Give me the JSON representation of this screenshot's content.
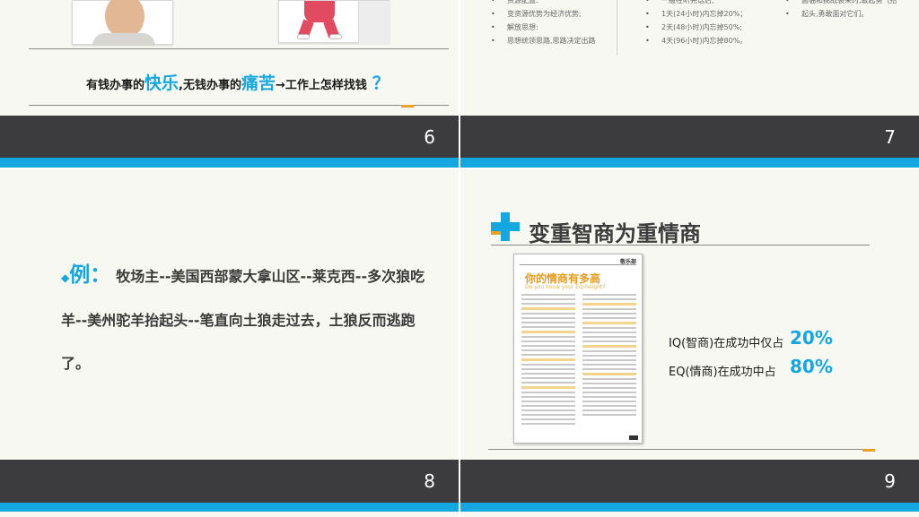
{
  "colors": {
    "accent_blue": "#14a7e0",
    "accent_orange": "#f0a020",
    "footer_bg": "#3c3c3e",
    "slide_bg": "#f8f8f3"
  },
  "slide6": {
    "number": "6",
    "heading_parts": [
      "有钱办事的",
      "快乐",
      ",无钱办事的",
      "痛苦",
      "→工作上怎样找钱",
      "？"
    ]
  },
  "slide7": {
    "number": "7",
    "col1": [
      "资源配置:",
      "变资源优势为经济优势;",
      "解放思想:",
      "思想统领思路,思路决定出路"
    ],
    "col2": [
      "一般在听完话后,",
      "1天(24小时)内忘掉20%；",
      "2天(48小时)内忘掉50%;",
      "4天(96小时)内忘掉80%。"
    ],
    "col3": [
      "面临和挑战袭来时,敢起勇气抬",
      "起头,勇敢面对它们。"
    ]
  },
  "slide8": {
    "number": "8",
    "example_label": "例：",
    "example_text": "牧场主--美国西部蒙大拿山区--莱克西--多次狼吃羊--美州驼羊抬起头--笔直向土狼走过去，土狼反而逃跑了。"
  },
  "slide9": {
    "number": "9",
    "title": "变重智商为重情商",
    "magazine_title": "你的情商有多高",
    "magazine_subtitle": "Do you know your EQ-height?",
    "magazine_brand": "敬乐部",
    "iq_label": "IQ(智商)在成功中仅占",
    "iq_value": "20%",
    "eq_label": "EQ(情商)在成功中占",
    "eq_value": "80%"
  }
}
